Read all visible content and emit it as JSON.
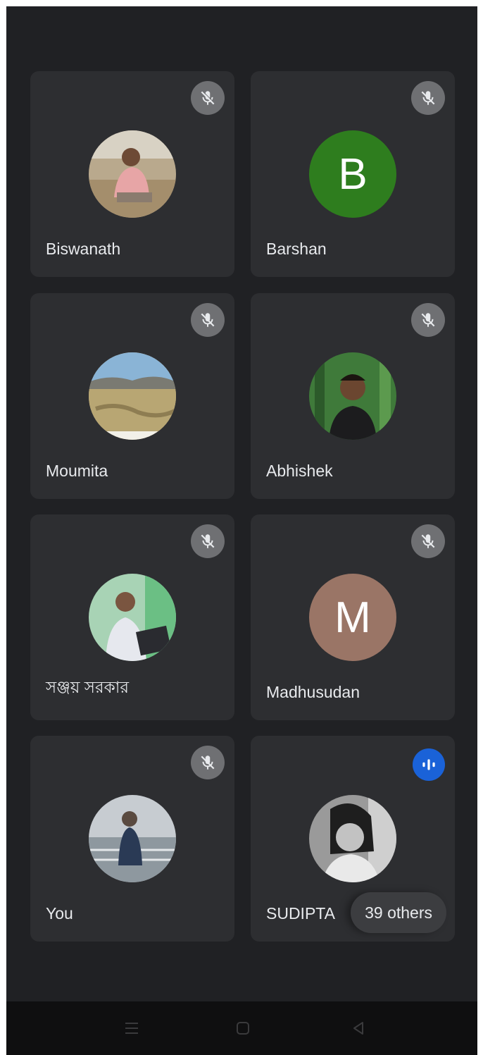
{
  "participants": [
    {
      "name": "Biswanath",
      "avatar": "photo",
      "mic": "muted"
    },
    {
      "name": "Barshan",
      "avatar": "letter",
      "letter": "B",
      "color": "#2e7d1e",
      "mic": "muted"
    },
    {
      "name": "Moumita",
      "avatar": "photo",
      "mic": "muted"
    },
    {
      "name": "Abhishek",
      "avatar": "photo",
      "mic": "muted"
    },
    {
      "name": "সঞ্জয় সরকার",
      "avatar": "photo",
      "mic": "muted"
    },
    {
      "name": "Madhusudan",
      "avatar": "letter",
      "letter": "M",
      "color": "#9a7566",
      "mic": "muted"
    },
    {
      "name": "You",
      "avatar": "photo",
      "mic": "muted"
    },
    {
      "name": "SUDIPTA",
      "avatar": "photo",
      "mic": "speaking"
    }
  ],
  "others_chip": {
    "label": "39 others"
  },
  "icons": {
    "mute": "mic-off-icon",
    "speaking": "audio-level-icon",
    "nav": [
      "menu-icon",
      "home-icon",
      "back-icon"
    ]
  },
  "colors": {
    "background": "#202124",
    "tile": "#2d2e31",
    "speaking_accent": "#1a62d8"
  }
}
